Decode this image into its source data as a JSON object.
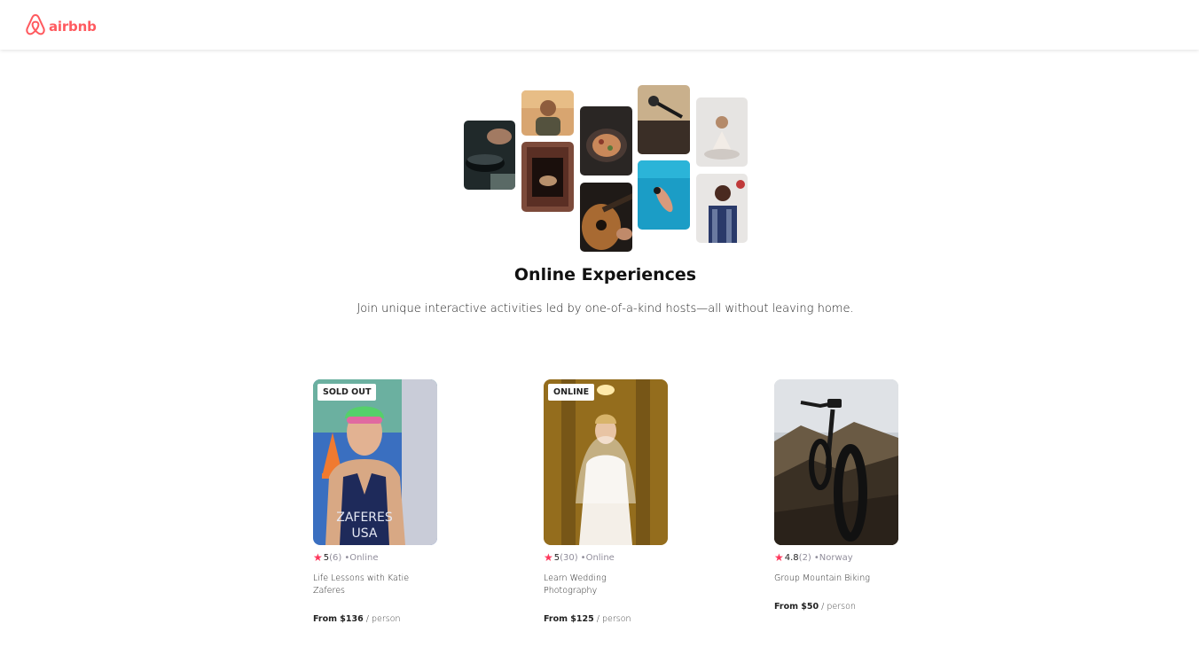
{
  "brand": {
    "name": "airbnb",
    "color": "#FF5A5F"
  },
  "hero": {
    "title": "Online Experiences",
    "subtitle": "Join unique interactive activities led by one-of-a-kind hosts—all without leaving home."
  },
  "cards": [
    {
      "badge": "SOLD OUT",
      "rating": "5",
      "review_count": "(6)",
      "location": "•Online",
      "title": "Life Lessons with Katie Zaferes",
      "price": "From $136",
      "per": "/ person"
    },
    {
      "badge": "ONLINE",
      "rating": "5",
      "review_count": "(30)",
      "location": "•Online",
      "title": "Learn Wedding Photography",
      "price": "From $125",
      "per": "/ person"
    },
    {
      "badge": "",
      "rating": "4.8",
      "review_count": "(2)",
      "location": "•Norway",
      "title": "Group Mountain Biking",
      "price": "From $50",
      "per": "/ person"
    }
  ],
  "colors": {
    "star": "#FE385C",
    "muted": "#918E9B"
  },
  "icons": {
    "logo": "airbnb-belo-icon",
    "rating": "star-icon"
  }
}
